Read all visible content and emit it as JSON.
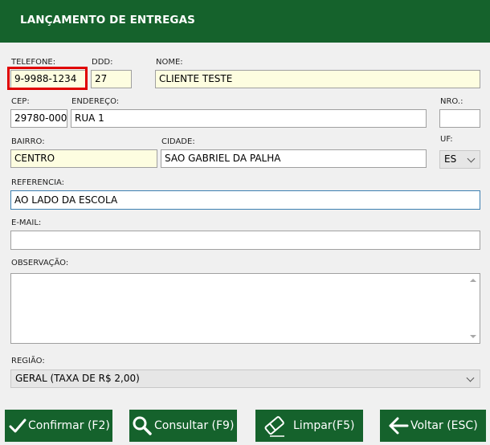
{
  "header": {
    "title": "LANÇAMENTO DE ENTREGAS"
  },
  "form": {
    "telefone": {
      "label": "TELEFONE:",
      "value": "9-9988-1234"
    },
    "ddd": {
      "label": "DDD:",
      "value": "27"
    },
    "nome": {
      "label": "NOME:",
      "value": "CLIENTE TESTE"
    },
    "cep": {
      "label": "CEP:",
      "value": "29780-000"
    },
    "endereco": {
      "label": "ENDEREÇO:",
      "value": "RUA 1"
    },
    "nro": {
      "label": "NRO.:",
      "value": ""
    },
    "bairro": {
      "label": "BAIRRO:",
      "value": "CENTRO"
    },
    "cidade": {
      "label": "CIDADE:",
      "value": "SAO GABRIEL DA PALHA"
    },
    "uf": {
      "label": "UF:",
      "value": "ES"
    },
    "referencia": {
      "label": "REFERENCIA:",
      "value": "AO LADO DA ESCOLA"
    },
    "email": {
      "label": "E-MAIL:",
      "value": ""
    },
    "observacao": {
      "label": "OBSERVAÇÃO:",
      "value": ""
    },
    "regiao": {
      "label": "REGIÃO:",
      "value": "GERAL (TAXA DE R$ 2,00)"
    }
  },
  "buttons": {
    "confirmar": "Confirmar (F2)",
    "consultar": "Consultar (F9)",
    "limpar": "Limpar(F5)",
    "voltar": "Voltar (ESC)"
  },
  "icons": [
    "check-icon",
    "magnifier-icon",
    "eraser-icon",
    "arrow-left-icon",
    "chevron-down-icon"
  ],
  "colors": {
    "header": "#15622c",
    "button": "#15622c",
    "highlight": "#e00000",
    "required_field": "#fdfde0"
  }
}
